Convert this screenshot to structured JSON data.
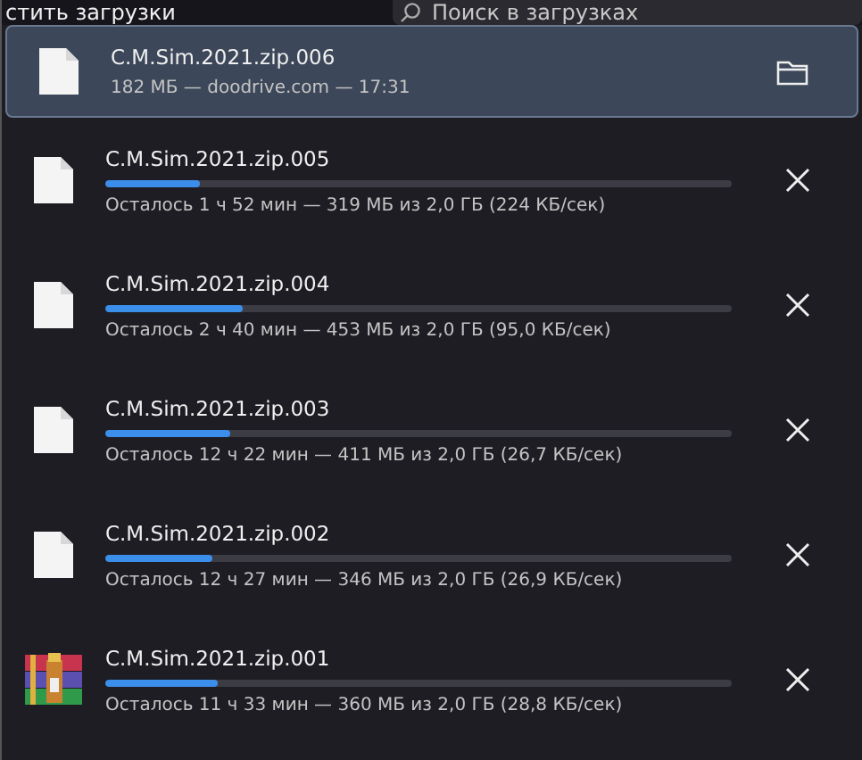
{
  "header": {
    "title": "стить загрузки",
    "search": {
      "placeholder": "Поиск в загрузках"
    }
  },
  "downloads": [
    {
      "name": "C.M.Sim.2021.zip.006",
      "kind": "done",
      "selected": true,
      "status": "182 МБ — doodrive.com — 17:31"
    },
    {
      "name": "C.M.Sim.2021.zip.005",
      "kind": "active",
      "selected": false,
      "level": 0.15,
      "status": "Осталось 1 ч 52 мин — 319 МБ из 2,0 ГБ (224 КБ/сек)"
    },
    {
      "name": "C.M.Sim.2021.zip.004",
      "kind": "active",
      "selected": false,
      "level": 0.22,
      "status": "Осталось 2 ч 40 мин — 453 МБ из 2,0 ГБ (95,0 КБ/сек)"
    },
    {
      "name": "C.M.Sim.2021.zip.003",
      "kind": "active",
      "selected": false,
      "level": 0.2,
      "status": "Осталось 12 ч 22 мин — 411 МБ из 2,0 ГБ (26,7 КБ/сек)"
    },
    {
      "name": "C.M.Sim.2021.zip.002",
      "kind": "active",
      "selected": false,
      "level": 0.17,
      "status": "Осталось 12 ч 27 мин — 346 МБ из 2,0 ГБ (26,9 КБ/сек)"
    },
    {
      "name": "C.M.Sim.2021.zip.001",
      "kind": "archive",
      "selected": false,
      "level": 0.18,
      "status": "Осталось 11 ч 33 мин — 360 МБ из 2,0 ГБ (28,8 КБ/сек)"
    }
  ]
}
